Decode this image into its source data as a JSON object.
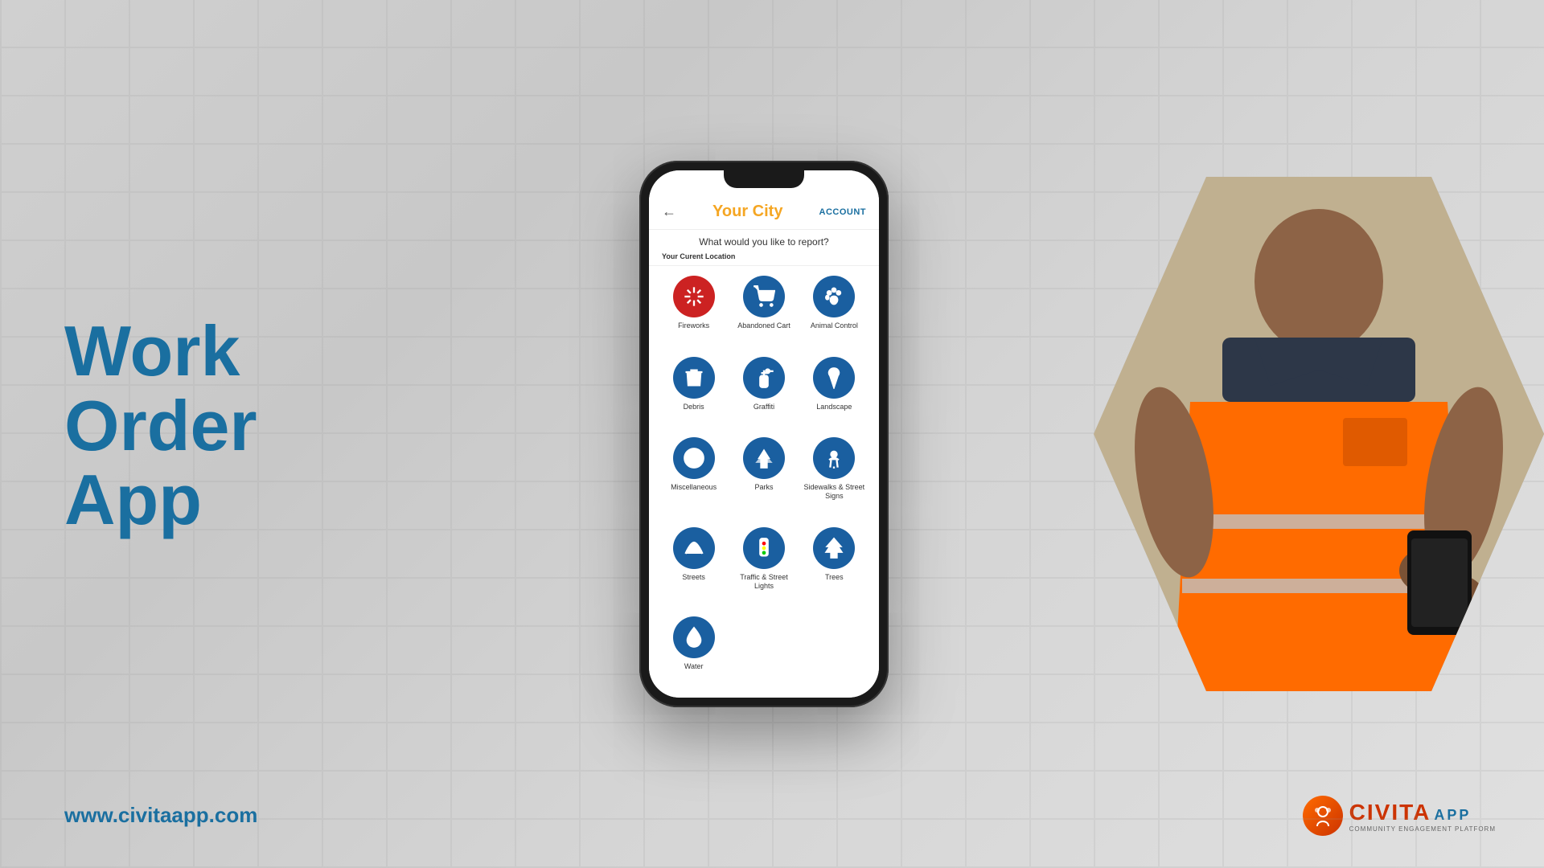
{
  "background": {
    "color": "#d8d8d8"
  },
  "left": {
    "title_line1": "Work Order",
    "title_line2": "App",
    "website": "www.civitaapp.com"
  },
  "phone": {
    "header": {
      "back_label": "←",
      "title": "Your City",
      "account_label": "ACCOUNT"
    },
    "subtitle": "What would you like to report?",
    "location_label": "Your Curent Location",
    "grid_items": [
      {
        "label": "Fireworks",
        "icon": "fireworks",
        "color": "red"
      },
      {
        "label": "Abandoned Cart",
        "icon": "cart",
        "color": "blue"
      },
      {
        "label": "Animal Control",
        "icon": "paw",
        "color": "blue"
      },
      {
        "label": "Debris",
        "icon": "trash",
        "color": "blue"
      },
      {
        "label": "Graffiti",
        "icon": "spray",
        "color": "blue"
      },
      {
        "label": "Landscape",
        "icon": "landscape",
        "color": "blue"
      },
      {
        "label": "Miscellaneous",
        "icon": "misc",
        "color": "blue"
      },
      {
        "label": "Parks",
        "icon": "parks",
        "color": "blue"
      },
      {
        "label": "Sidewalks & Street Signs",
        "icon": "sidewalk",
        "color": "blue"
      },
      {
        "label": "Streets",
        "icon": "streets",
        "color": "blue"
      },
      {
        "label": "Traffic & Street Lights",
        "icon": "traffic",
        "color": "blue"
      },
      {
        "label": "Trees",
        "icon": "trees",
        "color": "blue"
      },
      {
        "label": "Water",
        "icon": "water",
        "color": "blue"
      }
    ]
  },
  "logo": {
    "civita_text": "CIVITA",
    "app_text": "APP",
    "tagline": "COMMUNITY ENGAGEMENT PLATFORM"
  }
}
